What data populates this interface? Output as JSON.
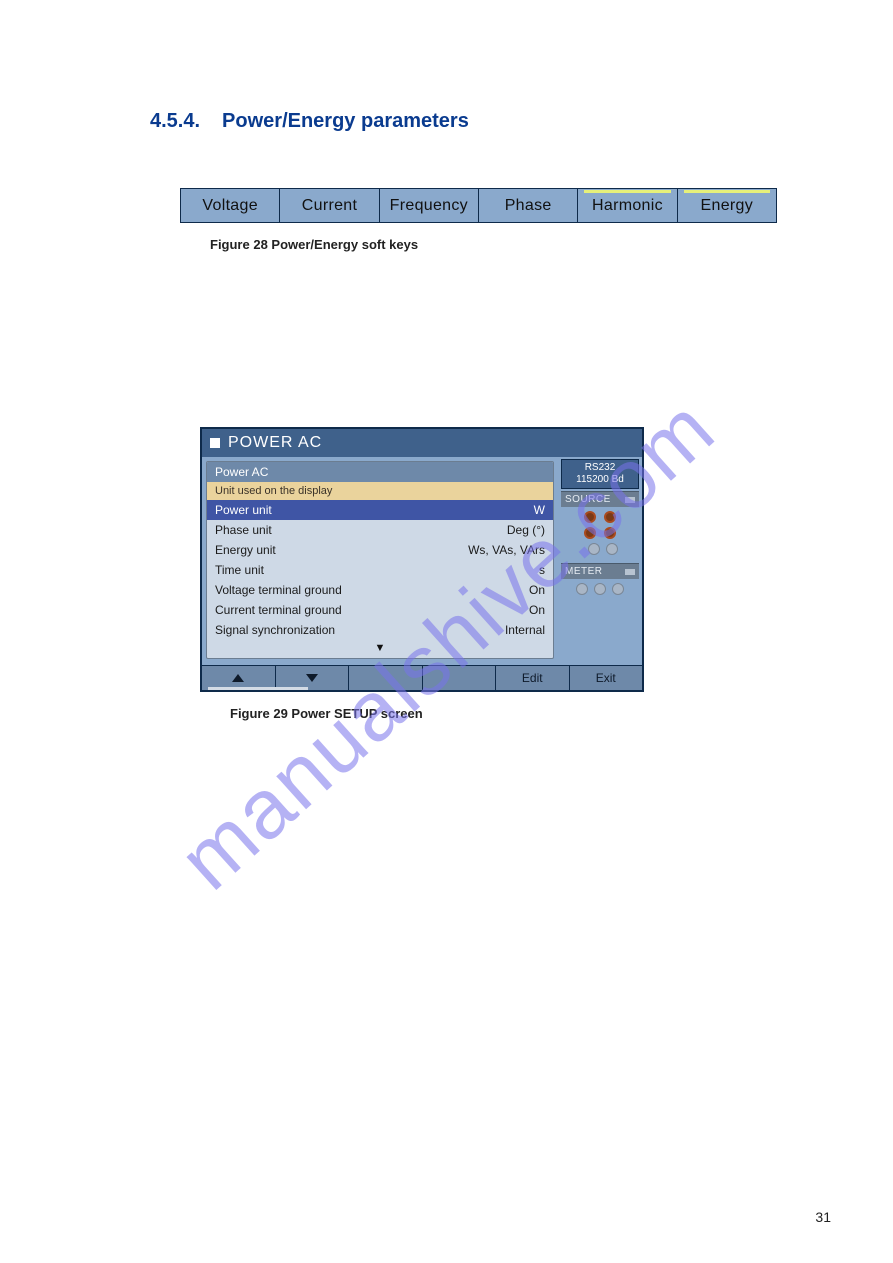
{
  "heading": {
    "number": "4.5.4.",
    "title": "Power/Energy parameters"
  },
  "softkeys": {
    "items": [
      {
        "label": "Voltage",
        "highlight": false
      },
      {
        "label": "Current",
        "highlight": false
      },
      {
        "label": "Frequency",
        "highlight": false
      },
      {
        "label": "Phase",
        "highlight": false
      },
      {
        "label": "Harmonic",
        "highlight": true
      },
      {
        "label": "Energy",
        "highlight": true
      }
    ],
    "caption": "Figure 28 Power/Energy soft keys"
  },
  "setup": {
    "title": "POWER AC",
    "rs_line1": "RS232",
    "rs_line2": "115200 Bd",
    "section": "Power AC",
    "hint": "Unit used on the display",
    "rows": [
      {
        "label": "Power unit",
        "value": "W",
        "selected": true
      },
      {
        "label": "Phase unit",
        "value": "Deg (°)",
        "selected": false
      },
      {
        "label": "Energy unit",
        "value": "Ws, VAs, VArs",
        "selected": false
      },
      {
        "label": "Time unit",
        "value": "s",
        "selected": false
      },
      {
        "label": "Voltage terminal ground",
        "value": "On",
        "selected": false
      },
      {
        "label": "Current terminal ground",
        "value": "On",
        "selected": false
      },
      {
        "label": "Signal synchronization",
        "value": "Internal",
        "selected": false
      }
    ],
    "more_indicator": "▼",
    "side": {
      "source_label": "SOURCE",
      "meter_label": "METER"
    },
    "buttons": {
      "up": "▲",
      "down": "▼",
      "b3": "",
      "b4": "",
      "edit": "Edit",
      "exit": "Exit"
    },
    "caption": "Figure 29 Power SETUP screen"
  },
  "watermark": "manualshive.com",
  "page_number": "31"
}
